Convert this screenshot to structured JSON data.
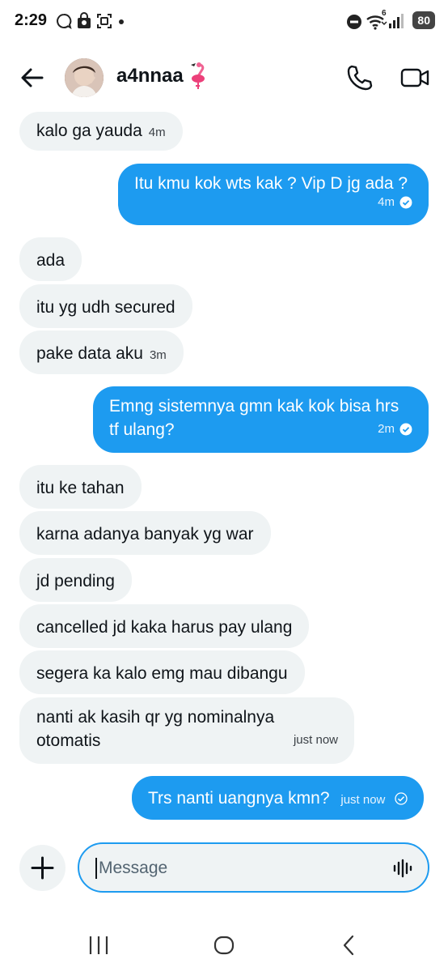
{
  "status_bar": {
    "time": "2:29",
    "network_label": "6",
    "battery": "80"
  },
  "header": {
    "contact_name": "a4nnaa",
    "emoji": "flamingo"
  },
  "messages": [
    {
      "dir": "in",
      "text": "kalo ga yauda",
      "time": "4m"
    },
    {
      "dir": "out",
      "text": "Itu kmu kok wts kak ? Vip D jg ada ?",
      "time": "4m",
      "status": "read"
    },
    {
      "dir": "in",
      "text": "ada"
    },
    {
      "dir": "in",
      "text": "itu yg udh secured"
    },
    {
      "dir": "in",
      "text": "pake data aku",
      "time": "3m"
    },
    {
      "dir": "out",
      "text": "Emng sistemnya gmn kak kok bisa hrs tf ulang?",
      "time": "2m",
      "status": "read"
    },
    {
      "dir": "in",
      "text": "itu ke tahan"
    },
    {
      "dir": "in",
      "text": "karna adanya banyak yg war"
    },
    {
      "dir": "in",
      "text": "jd pending"
    },
    {
      "dir": "in",
      "text": "cancelled jd kaka harus pay ulang"
    },
    {
      "dir": "in",
      "text": "segera ka kalo emg mau dibangu"
    },
    {
      "dir": "in",
      "text": "nanti ak kasih qr yg nominalnya otomatis",
      "time": "just now"
    },
    {
      "dir": "out",
      "text": "Trs nanti uangnya kmn?",
      "time": "just now",
      "status": "sent"
    }
  ],
  "composer": {
    "placeholder": "Message"
  },
  "icons": {
    "back": "arrow-left-icon",
    "call": "phone-icon",
    "video": "video-camera-icon",
    "add": "plus-icon",
    "voice": "waveform-icon"
  },
  "colors": {
    "accent": "#1d9bf0",
    "incoming_bubble": "#eff3f4",
    "text": "#0f1419"
  }
}
